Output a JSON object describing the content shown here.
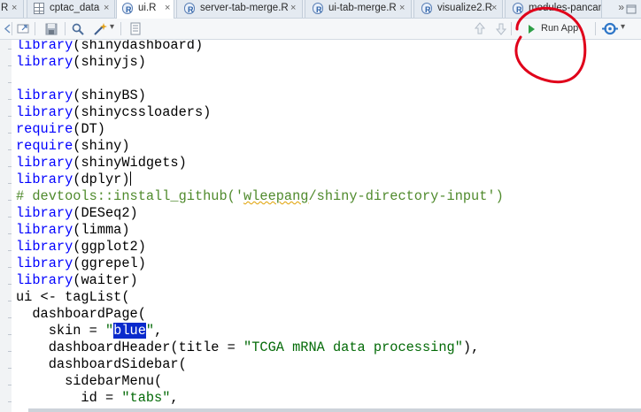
{
  "tabs": [
    {
      "label": "R",
      "close": "×",
      "icon": "r-file-icon"
    },
    {
      "label": "cptac_data",
      "close": "×",
      "icon": "data-grid-icon"
    },
    {
      "label": "ui.R",
      "close": "×",
      "icon": "r-file-icon",
      "active": true
    },
    {
      "label": "server-tab-merge.R",
      "close": "×",
      "icon": "r-file-icon"
    },
    {
      "label": "ui-tab-merge.R",
      "close": "×",
      "icon": "r-file-icon"
    },
    {
      "label": "visualize2.R",
      "close": "×",
      "icon": "r-file-icon"
    },
    {
      "label": "modules-pancan",
      "close": "",
      "icon": "r-file-icon"
    }
  ],
  "tabs_overflow": "»",
  "toolbar": {
    "run_app_label": "Run App",
    "publish_menu_arrow": "▾",
    "wand_menu_arrow": "▾"
  },
  "editor": {
    "lines": [
      [
        {
          "t": "library",
          "c": "fn"
        },
        {
          "t": "(shinydashboard)"
        }
      ],
      [
        {
          "t": "library",
          "c": "fn"
        },
        {
          "t": "(shinyjs)"
        }
      ],
      [],
      [
        {
          "t": "library",
          "c": "fn"
        },
        {
          "t": "(shinyBS)"
        }
      ],
      [
        {
          "t": "library",
          "c": "fn"
        },
        {
          "t": "(shinycssloaders)"
        }
      ],
      [
        {
          "t": "require",
          "c": "fn"
        },
        {
          "t": "(DT)"
        }
      ],
      [
        {
          "t": "require",
          "c": "fn"
        },
        {
          "t": "(shiny)"
        }
      ],
      [
        {
          "t": "library",
          "c": "fn"
        },
        {
          "t": "(shinyWidgets)"
        }
      ],
      [
        {
          "t": "library",
          "c": "fn"
        },
        {
          "t": "(dplyr)"
        },
        {
          "cursor": true
        }
      ],
      [
        {
          "t": "# devtools::install_github('",
          "c": "com"
        },
        {
          "t": "wleepang",
          "c": "com sq"
        },
        {
          "t": "/shiny-directory-input')",
          "c": "com"
        }
      ],
      [
        {
          "t": "library",
          "c": "fn"
        },
        {
          "t": "(DESeq2)"
        }
      ],
      [
        {
          "t": "library",
          "c": "fn"
        },
        {
          "t": "(limma)"
        }
      ],
      [
        {
          "t": "library",
          "c": "fn"
        },
        {
          "t": "(ggplot2)"
        }
      ],
      [
        {
          "t": "library",
          "c": "fn"
        },
        {
          "t": "(ggrepel)"
        }
      ],
      [
        {
          "t": "library",
          "c": "fn"
        },
        {
          "t": "(waiter)"
        }
      ],
      [
        {
          "t": "ui <- tagList("
        }
      ],
      [
        {
          "t": "  dashboardPage("
        }
      ],
      [
        {
          "t": "    skin = "
        },
        {
          "t": "\"",
          "c": "str"
        },
        {
          "t": "blue",
          "c": "sel"
        },
        {
          "t": "\"",
          "c": "str"
        },
        {
          "t": ","
        }
      ],
      [
        {
          "t": "    dashboardHeader(title = "
        },
        {
          "t": "\"TCGA mRNA data processing\"",
          "c": "str"
        },
        {
          "t": "),"
        }
      ],
      [
        {
          "t": "    dashboardSidebar("
        }
      ],
      [
        {
          "t": "      sidebarMenu("
        }
      ],
      [
        {
          "t": "        id = "
        },
        {
          "t": "\"tabs\"",
          "c": "str"
        },
        {
          "t": ","
        }
      ]
    ]
  },
  "colors": {
    "keyword": "#0000ff",
    "comment": "#4f8a2c",
    "string": "#036a07",
    "selection": "#0a2acc",
    "run_icon": "#2e9f47",
    "annotation_circle": "#e0001a"
  }
}
